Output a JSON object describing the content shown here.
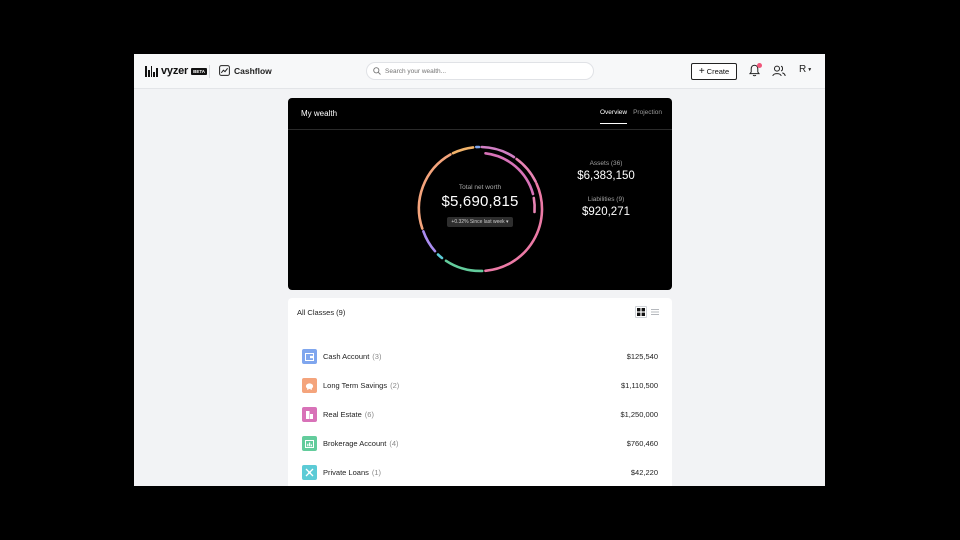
{
  "header": {
    "logo_text": "vyzer",
    "beta": "BETA",
    "nav_label": "Cashflow",
    "search_placeholder": "Search your wealth...",
    "create_label": "Create",
    "avatar_initial": "R"
  },
  "wealth": {
    "title": "My wealth",
    "tabs": [
      {
        "label": "Overview"
      },
      {
        "label": "Projection"
      }
    ],
    "net_worth_label": "Total net worth",
    "net_worth_value": "$5,690,815",
    "change_text": "+0.32% Since last week",
    "assets_label": "Assets (36)",
    "assets_value": "$6,383,150",
    "liabilities_label": "Liabilities (9)",
    "liabilities_value": "$920,271"
  },
  "classes": {
    "title": "All Classes (9)",
    "rows": [
      {
        "name": "Cash Account",
        "count": "(3)",
        "amount": "$125,540",
        "icon": "wallet-icon",
        "color": "#7fa6ee"
      },
      {
        "name": "Long Term Savings",
        "count": "(2)",
        "amount": "$1,110,500",
        "icon": "piggy-bank-icon",
        "color": "#f4a47c"
      },
      {
        "name": "Real Estate",
        "count": "(6)",
        "amount": "$1,250,000",
        "icon": "building-icon",
        "color": "#d872b8"
      },
      {
        "name": "Brokerage Account",
        "count": "(4)",
        "amount": "$760,460",
        "icon": "bar-chart-icon",
        "color": "#63cc9c"
      },
      {
        "name": "Private Loans",
        "count": "(1)",
        "amount": "$42,220",
        "icon": "handshake-icon",
        "color": "#5ccbd6"
      }
    ]
  },
  "colors": {
    "donut_gradient": [
      "#7fa6ee",
      "#f4a47c",
      "#d872b8",
      "#f06a94",
      "#63cc9c",
      "#5ccbd6",
      "#a98cf0"
    ]
  }
}
